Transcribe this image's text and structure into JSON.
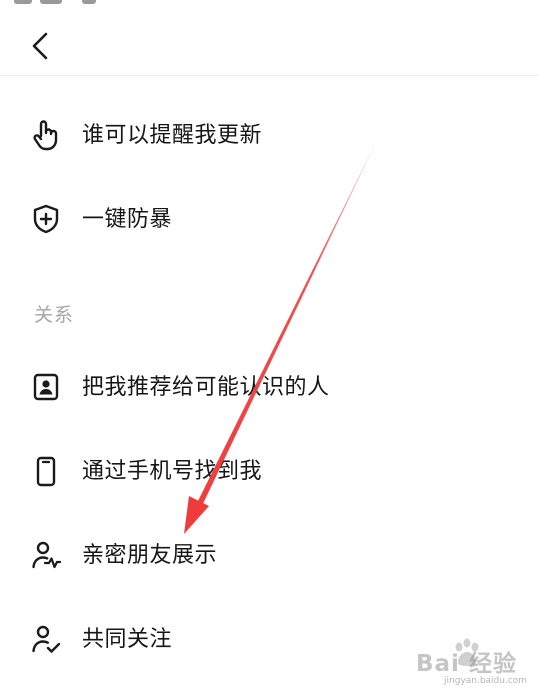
{
  "header": {
    "back_icon": "chevron-left-icon"
  },
  "items_top": [
    {
      "id": "who-can-remind",
      "label": "谁可以提醒我更新",
      "icon": "hand-pointer-icon"
    },
    {
      "id": "anti-harass",
      "label": "一键防暴",
      "icon": "shield-plus-icon"
    }
  ],
  "section": {
    "title": "关系"
  },
  "items_relation": [
    {
      "id": "recommend",
      "label": "把我推荐给可能认识的人",
      "icon": "contact-card-icon"
    },
    {
      "id": "find-by-phone",
      "label": "通过手机号找到我",
      "icon": "phone-icon"
    },
    {
      "id": "close-friends",
      "label": "亲密朋友展示",
      "icon": "user-heartbeat-icon"
    },
    {
      "id": "mutual-follow",
      "label": "共同关注",
      "icon": "user-check-icon"
    }
  ],
  "annotation": {
    "arrow_color": "#ee3c3c"
  },
  "watermark": {
    "text": "Bai 经验",
    "sub": "jingyan.baidu.com"
  }
}
